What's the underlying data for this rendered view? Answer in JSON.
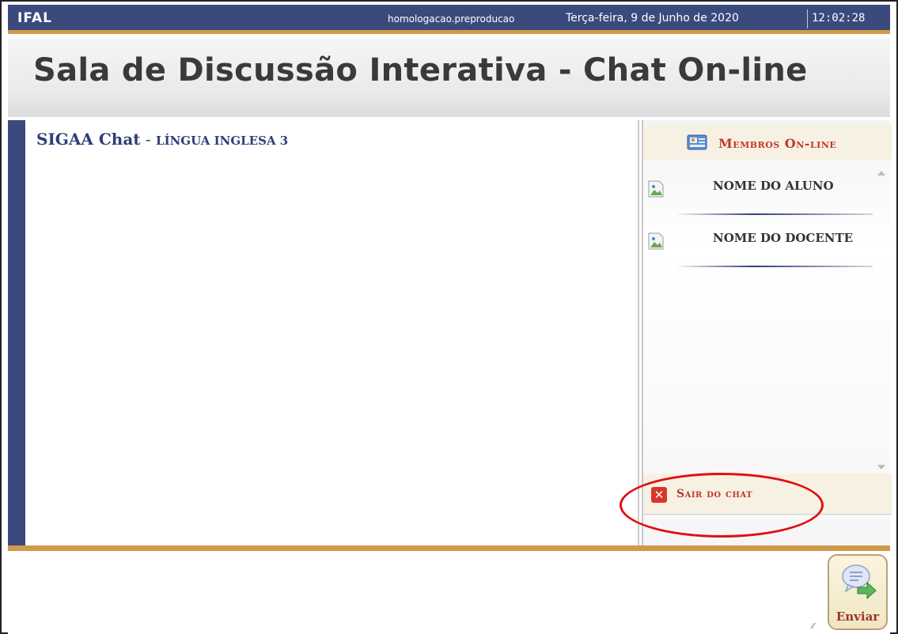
{
  "header": {
    "brand": "IFAL",
    "host": "homologacao.preproducao",
    "date": "Terça-feira, 9 de Junho de 2020",
    "time": "12:02:28"
  },
  "page": {
    "title": "Sala de Discussão Interativa - Chat On-line"
  },
  "chat": {
    "app_name": "SIGAA Chat",
    "separator": " - ",
    "course": "LÍNGUA INGLESA 3"
  },
  "sidebar": {
    "members_title": "Membros On-line",
    "members": [
      {
        "name": "NOME DO ALUNO"
      },
      {
        "name": "NOME DO DOCENTE"
      }
    ],
    "exit_label": "Sair do chat"
  },
  "composer": {
    "message_value": "",
    "send_label": "Enviar"
  },
  "colors": {
    "header_bg": "#3b4a7d",
    "accent_bar": "#d09a4a",
    "highlight_circle": "#e01010",
    "sidebar_label": "#c0392b"
  },
  "icons": {
    "members": "group-chat-icon",
    "member_avatar": "broken-image-icon",
    "exit": "close-icon",
    "send": "speech-bubble-send-icon"
  }
}
